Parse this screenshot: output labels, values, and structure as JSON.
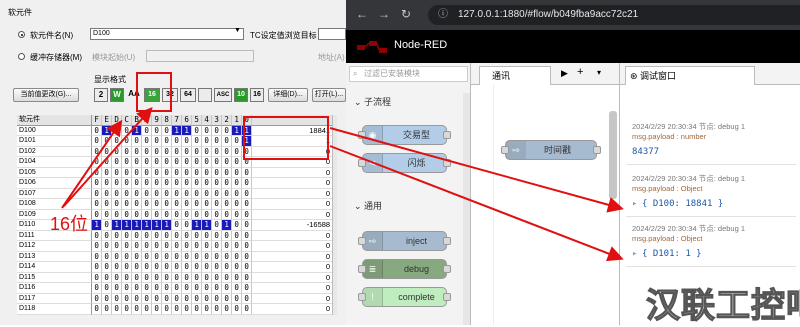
{
  "left": {
    "section_label": "软元件",
    "radio_device_name": "软元件名(N)",
    "device_value": "D100",
    "tc_label": "TC设定值浏览目标",
    "radio_buffer": "缓冲存储器(M)",
    "module_label": "模块起始(U)",
    "address_label": "地址(A)",
    "change_value_btn": "当前值更改(G)...",
    "display_format_label": "显示格式",
    "tb_labels": [
      "2",
      "W",
      "AA",
      "16",
      "32",
      "64",
      "",
      "ASC",
      "10",
      "16"
    ],
    "detail_btn": "详细(D)...",
    "open_btn": "打开(L)...",
    "header": {
      "name": "软元件",
      "bits": [
        "F",
        "E",
        "D",
        "C",
        "B",
        "A",
        "9",
        "8",
        "7",
        "6",
        "5",
        "4",
        "3",
        "2",
        "1",
        "0"
      ],
      "value": ""
    },
    "rows": [
      {
        "name": "D100",
        "bits": "0100100011000011",
        "value": "18841"
      },
      {
        "name": "D101",
        "bits": "0000000000000001",
        "value": "1"
      },
      {
        "name": "D102",
        "bits": "0000000000000000",
        "value": "0"
      },
      {
        "name": "D104",
        "bits": "0000000000000000",
        "value": "0"
      },
      {
        "name": "D105",
        "bits": "0000000000000000",
        "value": "0"
      },
      {
        "name": "D106",
        "bits": "0000000000000000",
        "value": "0"
      },
      {
        "name": "D107",
        "bits": "0000000000000000",
        "value": "0"
      },
      {
        "name": "D108",
        "bits": "0000000000000000",
        "value": "0"
      },
      {
        "name": "D109",
        "bits": "0000000000000000",
        "value": "0"
      },
      {
        "name": "D110",
        "bits": "1011111100110100",
        "value": "-16588"
      },
      {
        "name": "D111",
        "bits": "0000000000000000",
        "value": "0"
      },
      {
        "name": "D112",
        "bits": "0000000000000000",
        "value": "0"
      },
      {
        "name": "D113",
        "bits": "0000000000000000",
        "value": "0"
      },
      {
        "name": "D114",
        "bits": "0000000000000000",
        "value": "0"
      },
      {
        "name": "D115",
        "bits": "0000000000000000",
        "value": "0"
      },
      {
        "name": "D116",
        "bits": "0000000000000000",
        "value": "0"
      },
      {
        "name": "D117",
        "bits": "0000000000000000",
        "value": "0"
      },
      {
        "name": "D118",
        "bits": "0000000000000000",
        "value": "0"
      }
    ],
    "annotation": "16位"
  },
  "browser": {
    "url": "127.0.0.1:1880/#flow/b049fba9acc72c21"
  },
  "nodered": {
    "title": "Node-RED",
    "filter_placeholder": "过滤已安装模块",
    "cat_subflow": "子流程",
    "cat_common": "通用",
    "palette_nodes": [
      {
        "label": "交易型",
        "color": "#b3cde8",
        "icon": "toggle-icon"
      },
      {
        "label": "闪烁",
        "color": "#b3cde8",
        "icon": "share-icon"
      },
      {
        "label": "inject",
        "color": "#a6bbcf",
        "icon": "arrow-icon"
      },
      {
        "label": "debug",
        "color": "#87a980",
        "icon": "bug-icon"
      },
      {
        "label": "complete",
        "color": "#c0edc0",
        "icon": "exclamation-icon"
      }
    ],
    "workspace_tab": "通讯",
    "workspace_node": "时间戳",
    "debug_tab": "调试窗口",
    "messages": [
      {
        "meta": "2024/2/29 20:30:34  节点: debug 1",
        "type": "msg.payload : number",
        "value": "84377"
      },
      {
        "meta": "2024/2/29 20:30:34  节点: debug 1",
        "type": "msg.payload : Object",
        "value": "{ D100: 18841 }"
      },
      {
        "meta": "2024/2/29 20:30:34  节点: debug 1",
        "type": "msg.payload : Object",
        "value": "{ D101: 1 }"
      }
    ]
  },
  "watermark": "汉联工控吧",
  "colors": {
    "accent_red": "#e01010",
    "bit_on": "#1a1ab8",
    "nodered_header": "#000000"
  }
}
